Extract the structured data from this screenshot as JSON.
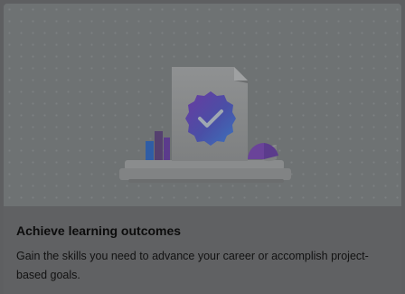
{
  "card": {
    "title": "Achieve learning outcomes",
    "description": "Gain the skills you need to advance your career or accomplish project-based goals.",
    "illustration_icon": "certificate-badge-check-icon"
  },
  "colors": {
    "page_overlay": "#5e5f61",
    "hero_background": "#6e7273",
    "badge_purple": "#5f3c9e",
    "badge_blue": "#3c6fb8"
  }
}
